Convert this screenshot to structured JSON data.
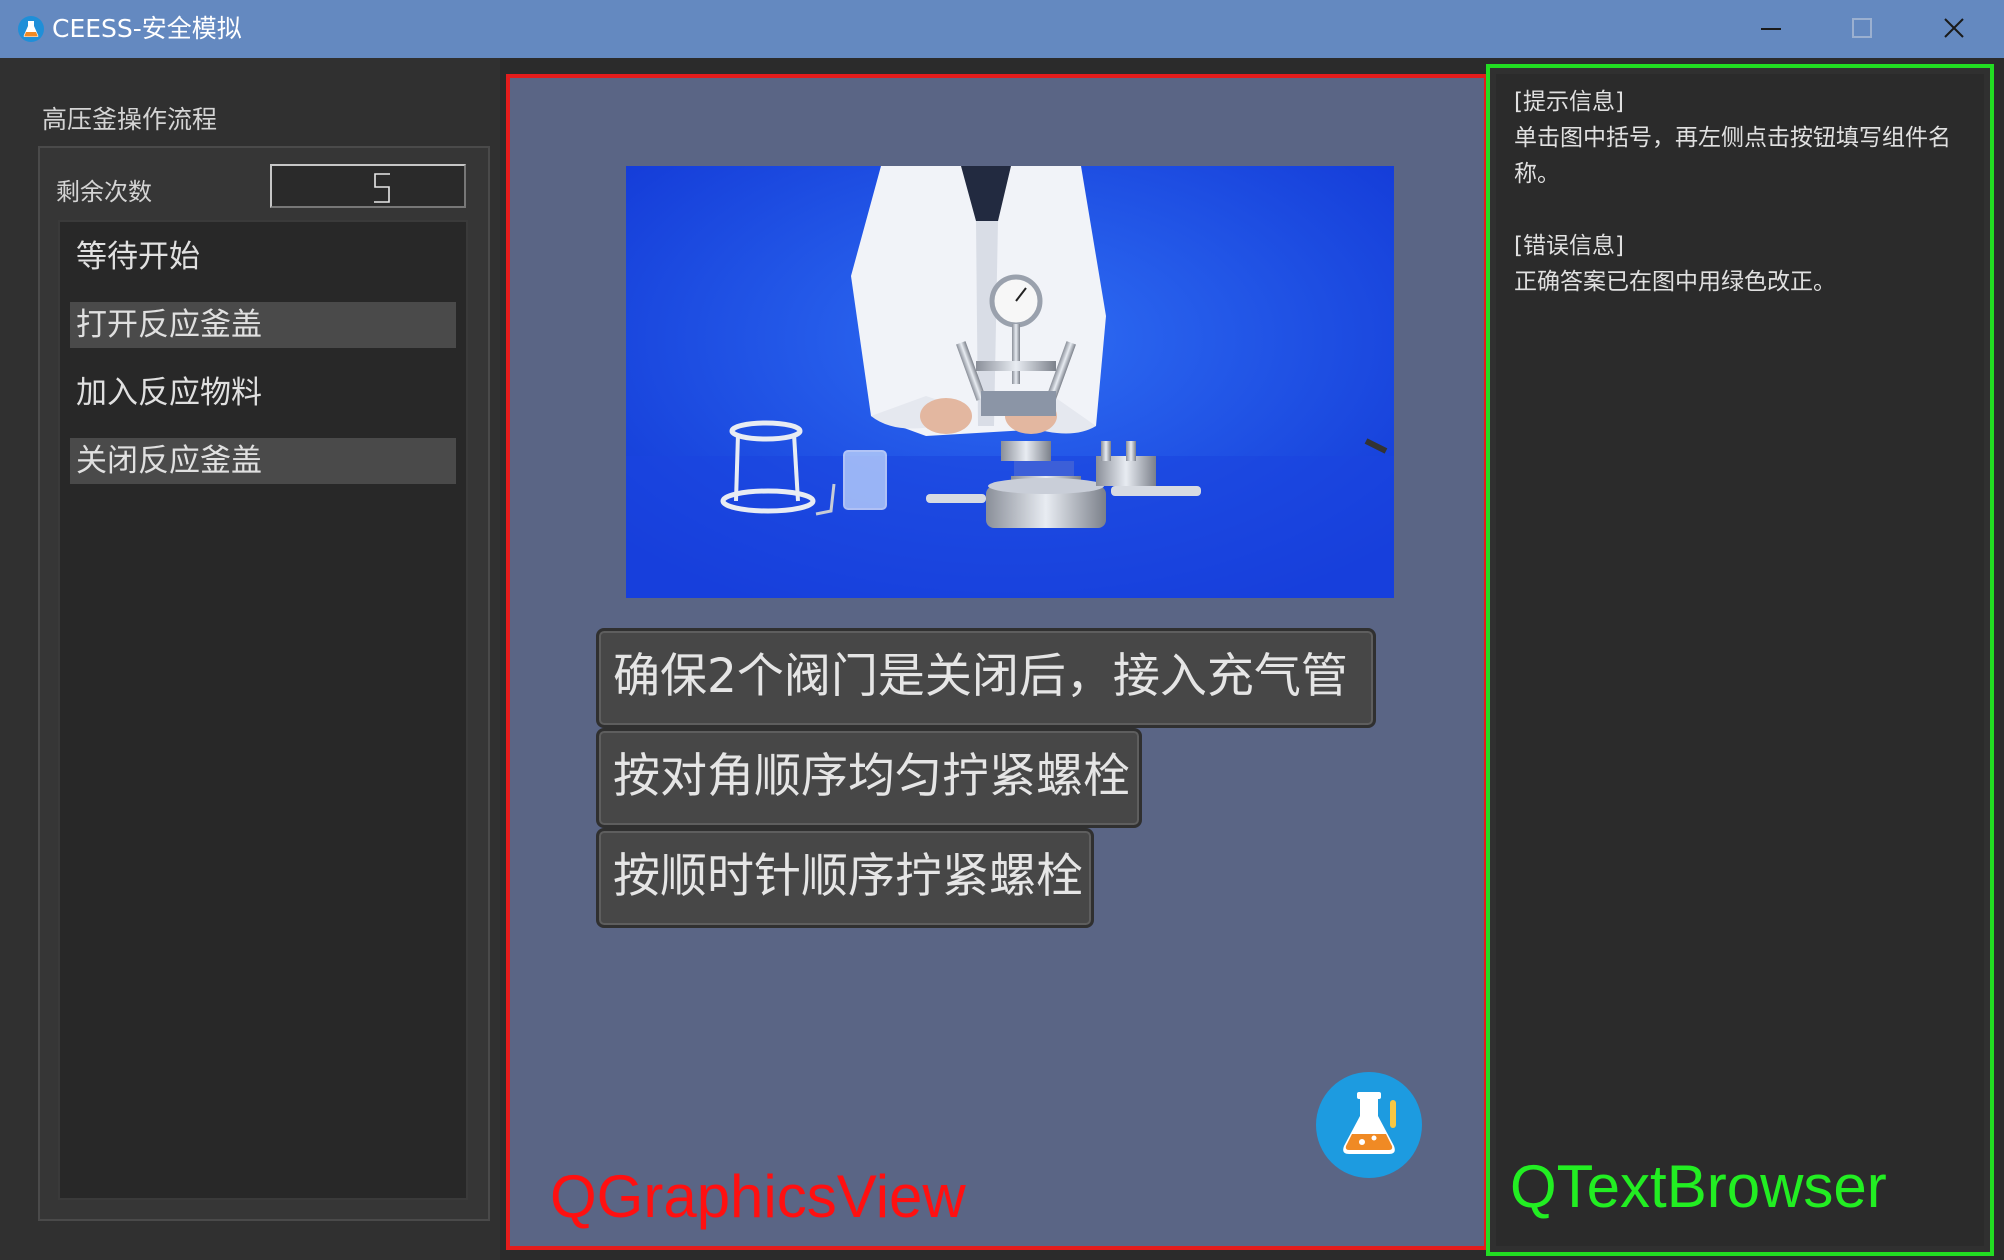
{
  "window": {
    "title": "CEESS-安全模拟",
    "icons": {
      "app": "flask-icon",
      "minimize": "minimize-icon",
      "maximize": "maximize-icon",
      "close": "close-icon"
    }
  },
  "left_panel": {
    "group_title": "高压釜操作流程",
    "remaining_label": "剩余次数",
    "remaining_value": "5",
    "steps": [
      {
        "label": "等待开始"
      },
      {
        "label": "打开反应釜盖"
      },
      {
        "label": "加入反应物料"
      },
      {
        "label": "关闭反应釜盖"
      }
    ]
  },
  "graphics_view": {
    "answers": [
      {
        "label": "确保2个阀门是关闭后，接入充气管"
      },
      {
        "label": "按对角顺序均匀拧紧螺栓"
      },
      {
        "label": "按顺时针顺序拧紧螺栓"
      }
    ],
    "annotation": "QGraphicsView",
    "logo_icon": "flask-logo-icon"
  },
  "text_browser": {
    "hint_heading": "[提示信息]",
    "hint_text": "单击图中括号，再左侧点击按钮填写组件名称。",
    "error_heading": "[错误信息]",
    "error_text": "正确答案已在图中用绿色改正。",
    "annotation": "QTextBrowser"
  },
  "colors": {
    "titlebar": "#6489c0",
    "graphics_view_border": "#e31c1c",
    "text_browser_border": "#22dd22",
    "view_background": "#5a6585"
  }
}
